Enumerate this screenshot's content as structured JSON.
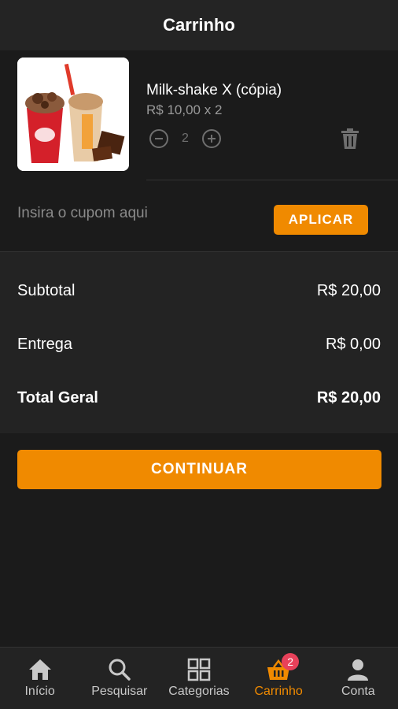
{
  "header": {
    "title": "Carrinho"
  },
  "cart": {
    "item": {
      "name": "Milk-shake X (cópia)",
      "price": "R$ 10,00 x 2",
      "quantity": "2",
      "image": "milkshake-photo"
    }
  },
  "coupon": {
    "placeholder": "Insira o cupom aqui",
    "apply_label": "APLICAR"
  },
  "totals": {
    "subtotal_label": "Subtotal",
    "subtotal_value": "R$ 20,00",
    "delivery_label": "Entrega",
    "delivery_value": "R$ 0,00",
    "grand_label": "Total Geral",
    "grand_value": "R$ 20,00"
  },
  "continue_label": "CONTINUAR",
  "tabbar": {
    "tabs": [
      {
        "label": "Início",
        "icon": "home-icon"
      },
      {
        "label": "Pesquisar",
        "icon": "search-icon"
      },
      {
        "label": "Categorias",
        "icon": "grid-icon"
      },
      {
        "label": "Carrinho",
        "icon": "basket-icon",
        "badge": "2",
        "active": true
      },
      {
        "label": "Conta",
        "icon": "user-icon"
      }
    ]
  },
  "colors": {
    "accent": "#f08a00",
    "badge": "#e8415a",
    "background": "#1b1b1b"
  }
}
